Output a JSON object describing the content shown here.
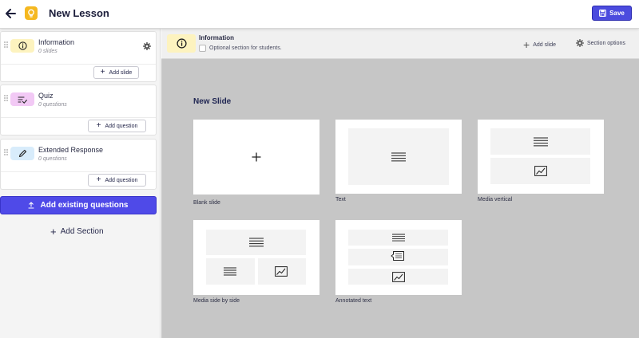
{
  "app": {
    "title": "New Lesson",
    "save_label": "Save"
  },
  "sections": [
    {
      "name": "Information",
      "count": "0 slides",
      "button": "Add slide",
      "icon": "info-icon",
      "color": "#fdf3bf"
    },
    {
      "name": "Quiz",
      "count": "0 questions",
      "button": "Add question",
      "icon": "checklist-icon",
      "color": "#f2c9f5"
    },
    {
      "name": "Extended Response",
      "count": "0 questions",
      "button": "Add question",
      "icon": "pencil-icon",
      "color": "#d8ecfb"
    }
  ],
  "sidebar": {
    "add_existing": "Add existing questions",
    "add_section": "Add Section"
  },
  "subheader": {
    "title": "Information",
    "optional_label": "Optional section for students.",
    "add_slide": "Add slide",
    "section_options": "Section options"
  },
  "new_slide": {
    "title": "New Slide",
    "templates": [
      "Blank slide",
      "Text",
      "Media vertical",
      "Media side by side",
      "Annotated text"
    ]
  },
  "colors": {
    "accent": "#4f4ae8",
    "main_bg": "#c6c6c6",
    "logo": "#f5b820"
  }
}
